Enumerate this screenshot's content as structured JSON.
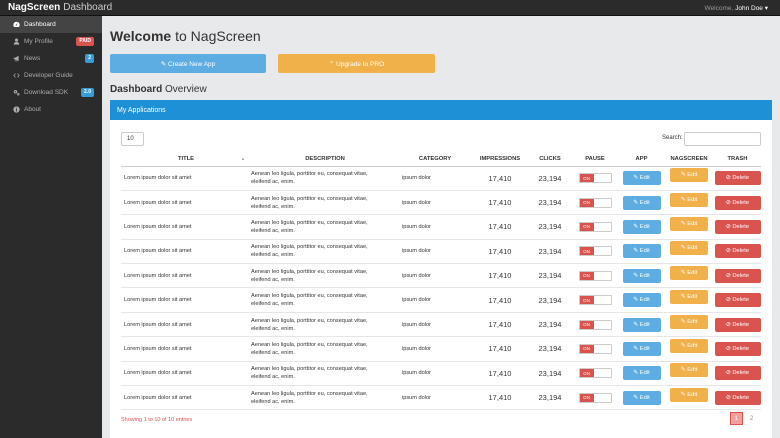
{
  "header": {
    "brand_bold": "NagScreen",
    "brand_sub": "Dashboard",
    "welcome_prefix": "Welcome,",
    "user_name": "John Doe ▾"
  },
  "sidebar": {
    "items": [
      {
        "label": "Dashboard",
        "icon": "dashboard-icon",
        "active": true
      },
      {
        "label": "My Profile",
        "icon": "user-icon",
        "badge": "PAID",
        "badge_color": "#d9534f"
      },
      {
        "label": "News",
        "icon": "megaphone-icon",
        "badge": "2",
        "badge_color": "#3a9bd9"
      },
      {
        "label": "Developer Guide",
        "icon": "code-icon"
      },
      {
        "label": "Download SDK",
        "icon": "cogs-icon",
        "badge": "2.0",
        "badge_color": "#3a9bd9"
      },
      {
        "label": "About",
        "icon": "info-icon"
      }
    ]
  },
  "main": {
    "title_bold": "Welcome",
    "title_rest": " to NagScreen",
    "create_button": "✎ Create New App",
    "upgrade_button": "⌃ Upgrade to PRO",
    "section_bold": "Dashboard",
    "section_rest": " Overview",
    "panel_title": "My Applications",
    "page_length": "10",
    "search_label": "Search:",
    "columns": [
      "TITLE",
      "DESCRIPTION",
      "CATEGORY",
      "IMPRESSIONS",
      "CLICKS",
      "PAUSE",
      "APP",
      "NAGSCREEN",
      "TRASH"
    ],
    "toggle_label": "ON",
    "edit_label": "✎ Edit",
    "delete_label": "⊘ Delete",
    "rows": [
      {
        "title": "Lorem ipsum dolor sit amet",
        "desc1": "Aenean leo ligula, porttitor eu, consequat vitae,",
        "desc2": "eleifend ac, enim.",
        "category": "ipsum dolor",
        "impressions": "17,410",
        "clicks": "23,194"
      },
      {
        "title": "Lorem ipsum dolor sit amet",
        "desc1": "Aenean leo ligula, porttitor eu, consequat vitae,",
        "desc2": "eleifend ac, enim.",
        "category": "ipsum dolor",
        "impressions": "17,410",
        "clicks": "23,194"
      },
      {
        "title": "Lorem ipsum dolor sit amet",
        "desc1": "Aenean leo ligula, porttitor eu, consequat vitae,",
        "desc2": "eleifend ac, enim.",
        "category": "ipsum dolor",
        "impressions": "17,410",
        "clicks": "23,194"
      },
      {
        "title": "Lorem ipsum dolor sit amet",
        "desc1": "Aenean leo ligula, porttitor eu, consequat vitae,",
        "desc2": "eleifend ac, enim.",
        "category": "ipsum dolor",
        "impressions": "17,410",
        "clicks": "23,194"
      },
      {
        "title": "Lorem ipsum dolor sit amet",
        "desc1": "Aenean leo ligula, porttitor eu, consequat vitae,",
        "desc2": "eleifend ac, enim.",
        "category": "ipsum dolor",
        "impressions": "17,410",
        "clicks": "23,194"
      },
      {
        "title": "Lorem ipsum dolor sit amet",
        "desc1": "Aenean leo ligula, porttitor eu, consequat vitae,",
        "desc2": "eleifend ac, enim.",
        "category": "ipsum dolor",
        "impressions": "17,410",
        "clicks": "23,194"
      },
      {
        "title": "Lorem ipsum dolor sit amet",
        "desc1": "Aenean leo ligula, porttitor eu, consequat vitae,",
        "desc2": "eleifend ac, enim.",
        "category": "ipsum dolor",
        "impressions": "17,410",
        "clicks": "23,194"
      },
      {
        "title": "Lorem ipsum dolor sit amet",
        "desc1": "Aenean leo ligula, porttitor eu, consequat vitae,",
        "desc2": "eleifend ac, enim.",
        "category": "ipsum dolor",
        "impressions": "17,410",
        "clicks": "23,194"
      },
      {
        "title": "Lorem ipsum dolor sit amet",
        "desc1": "Aenean leo ligula, porttitor eu, consequat vitae,",
        "desc2": "eleifend ac, enim.",
        "category": "ipsum dolor",
        "impressions": "17,410",
        "clicks": "23,194"
      },
      {
        "title": "Lorem ipsum dolor sit amet",
        "desc1": "Aenean leo ligula, porttitor eu, consequat vitae,",
        "desc2": "eleifend ac, enim.",
        "category": "ipsum dolor",
        "impressions": "17,410",
        "clicks": "23,194"
      }
    ],
    "info_text": "Showing 1 to 10 of 10 entries",
    "pages": [
      "1",
      "2"
    ],
    "current_page": "1"
  },
  "colors": {
    "accent_blue": "#1e90d6",
    "button_blue": "#5dade2",
    "button_orange": "#f0b04a",
    "danger_red": "#d9534f",
    "sidebar_bg": "#2b2b2b"
  }
}
